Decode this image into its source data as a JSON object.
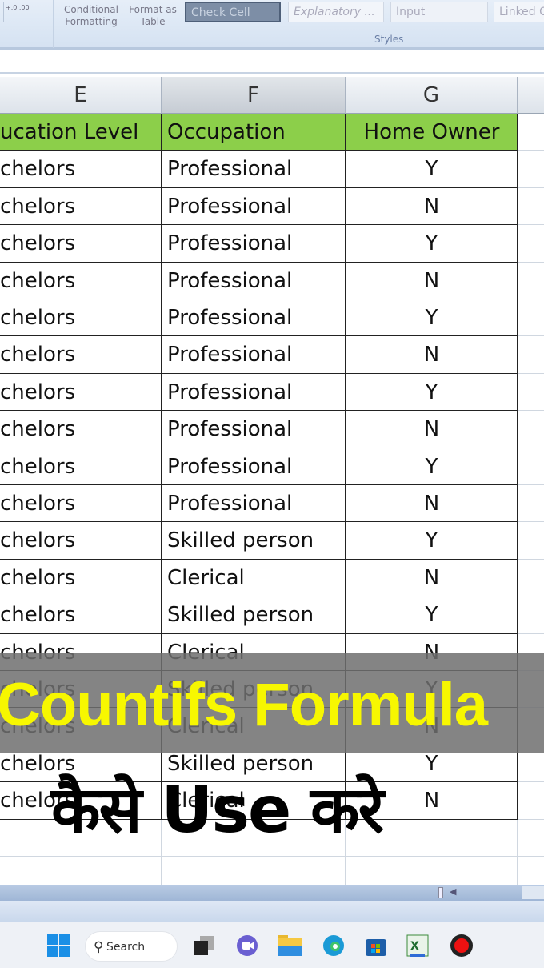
{
  "ribbon": {
    "number_format_icons": "+.0 .00",
    "conditional_formatting": "Conditional Formatting",
    "format_as_table": "Format as Table",
    "styles": [
      "Check Cell",
      "Explanatory ...",
      "Input",
      "Linked C"
    ],
    "group_label": "Styles"
  },
  "columns": [
    "E",
    "F",
    "G"
  ],
  "selected_column": "F",
  "header_row": [
    "ucation Level",
    "Occupation",
    "Home Owner"
  ],
  "header_color": "#8ccf4a",
  "rows": [
    [
      "chelors",
      "Professional",
      "Y"
    ],
    [
      "chelors",
      "Professional",
      "N"
    ],
    [
      "chelors",
      "Professional",
      "Y"
    ],
    [
      "chelors",
      "Professional",
      "N"
    ],
    [
      "chelors",
      "Professional",
      "Y"
    ],
    [
      "chelors",
      "Professional",
      "N"
    ],
    [
      "chelors",
      "Professional",
      "Y"
    ],
    [
      "chelors",
      "Professional",
      "N"
    ],
    [
      "chelors",
      "Professional",
      "Y"
    ],
    [
      "chelors",
      "Professional",
      "N"
    ],
    [
      "chelors",
      "Skilled person",
      "Y"
    ],
    [
      "chelors",
      "Clerical",
      "N"
    ],
    [
      "chelors",
      "Skilled person",
      "Y"
    ],
    [
      "chelors",
      "Clerical",
      "N"
    ],
    [
      "chelors",
      "Skilled person",
      "Y"
    ],
    [
      "chelors",
      "Clerical",
      "N"
    ],
    [
      "chelors",
      "Skilled person",
      "Y"
    ],
    [
      "chelors",
      "Clerical",
      "N"
    ]
  ],
  "overlay": {
    "title": "Countifs Formula",
    "subtitle": "कैसे Use करे",
    "title_color": "#f7f700"
  },
  "taskbar": {
    "search_label": "Search",
    "icons": [
      "windows-start-icon",
      "task-view-icon",
      "teams-meet-icon",
      "file-explorer-icon",
      "edge-icon",
      "store-icon",
      "excel-icon",
      "recorder-icon"
    ]
  }
}
